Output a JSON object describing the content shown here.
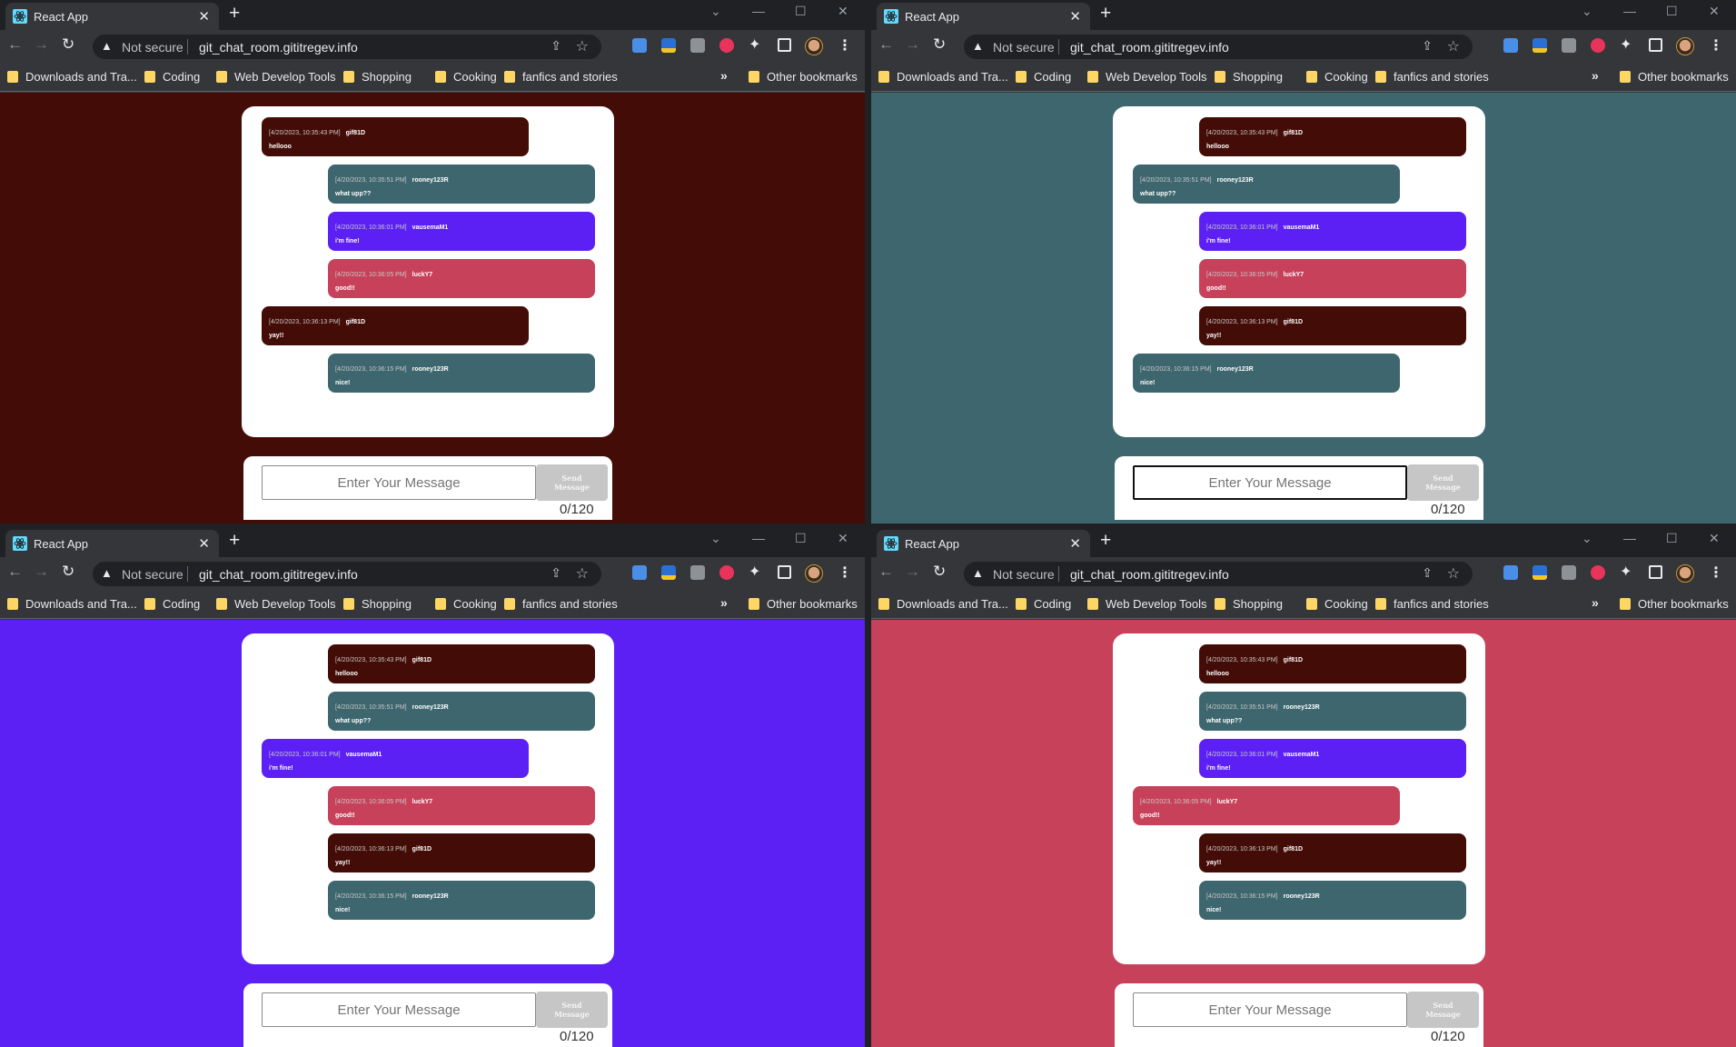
{
  "browser": {
    "tab_title": "React App",
    "not_secure_label": "Not secure",
    "url": "git_chat_room.gititregev.info",
    "bookmarks": [
      "Downloads and Tra...",
      "Coding",
      "Web Develop Tools",
      "Shopping",
      "Cooking",
      "fanfics and stories"
    ],
    "other_bookmarks": "Other bookmarks",
    "overflow_chevron": "»"
  },
  "user_colors": {
    "gif81D": "#440c06",
    "rooney123R": "#3d666e",
    "vausemaM1": "#5c20f5",
    "luckY7": "#c7415a"
  },
  "messages": [
    {
      "timestamp": "[4/20/2023, 10:35:43 PM]",
      "user": "gif81D",
      "text": "hellooo"
    },
    {
      "timestamp": "[4/20/2023, 10:35:51 PM]",
      "user": "rooney123R",
      "text": "what upp??"
    },
    {
      "timestamp": "[4/20/2023, 10:36:01 PM]",
      "user": "vausemaM1",
      "text": "i'm fine!"
    },
    {
      "timestamp": "[4/20/2023, 10:36:05 PM]",
      "user": "luckY7",
      "text": "good!!"
    },
    {
      "timestamp": "[4/20/2023, 10:36:13 PM]",
      "user": "gif81D",
      "text": "yay!!"
    },
    {
      "timestamp": "[4/20/2023, 10:36:15 PM]",
      "user": "rooney123R",
      "text": "nice!"
    }
  ],
  "composer": {
    "placeholder": "Enter Your Message",
    "send_label": "Send Message",
    "counter": "0/120"
  },
  "windows": [
    {
      "current_user": "gif81D",
      "background": "#440c06",
      "input_focused": false
    },
    {
      "current_user": "rooney123R",
      "background": "#3d666e",
      "input_focused": true
    },
    {
      "current_user": "vausemaM1",
      "background": "#5c20f5",
      "input_focused": false
    },
    {
      "current_user": "luckY7",
      "background": "#c7415a",
      "input_focused": false
    }
  ]
}
